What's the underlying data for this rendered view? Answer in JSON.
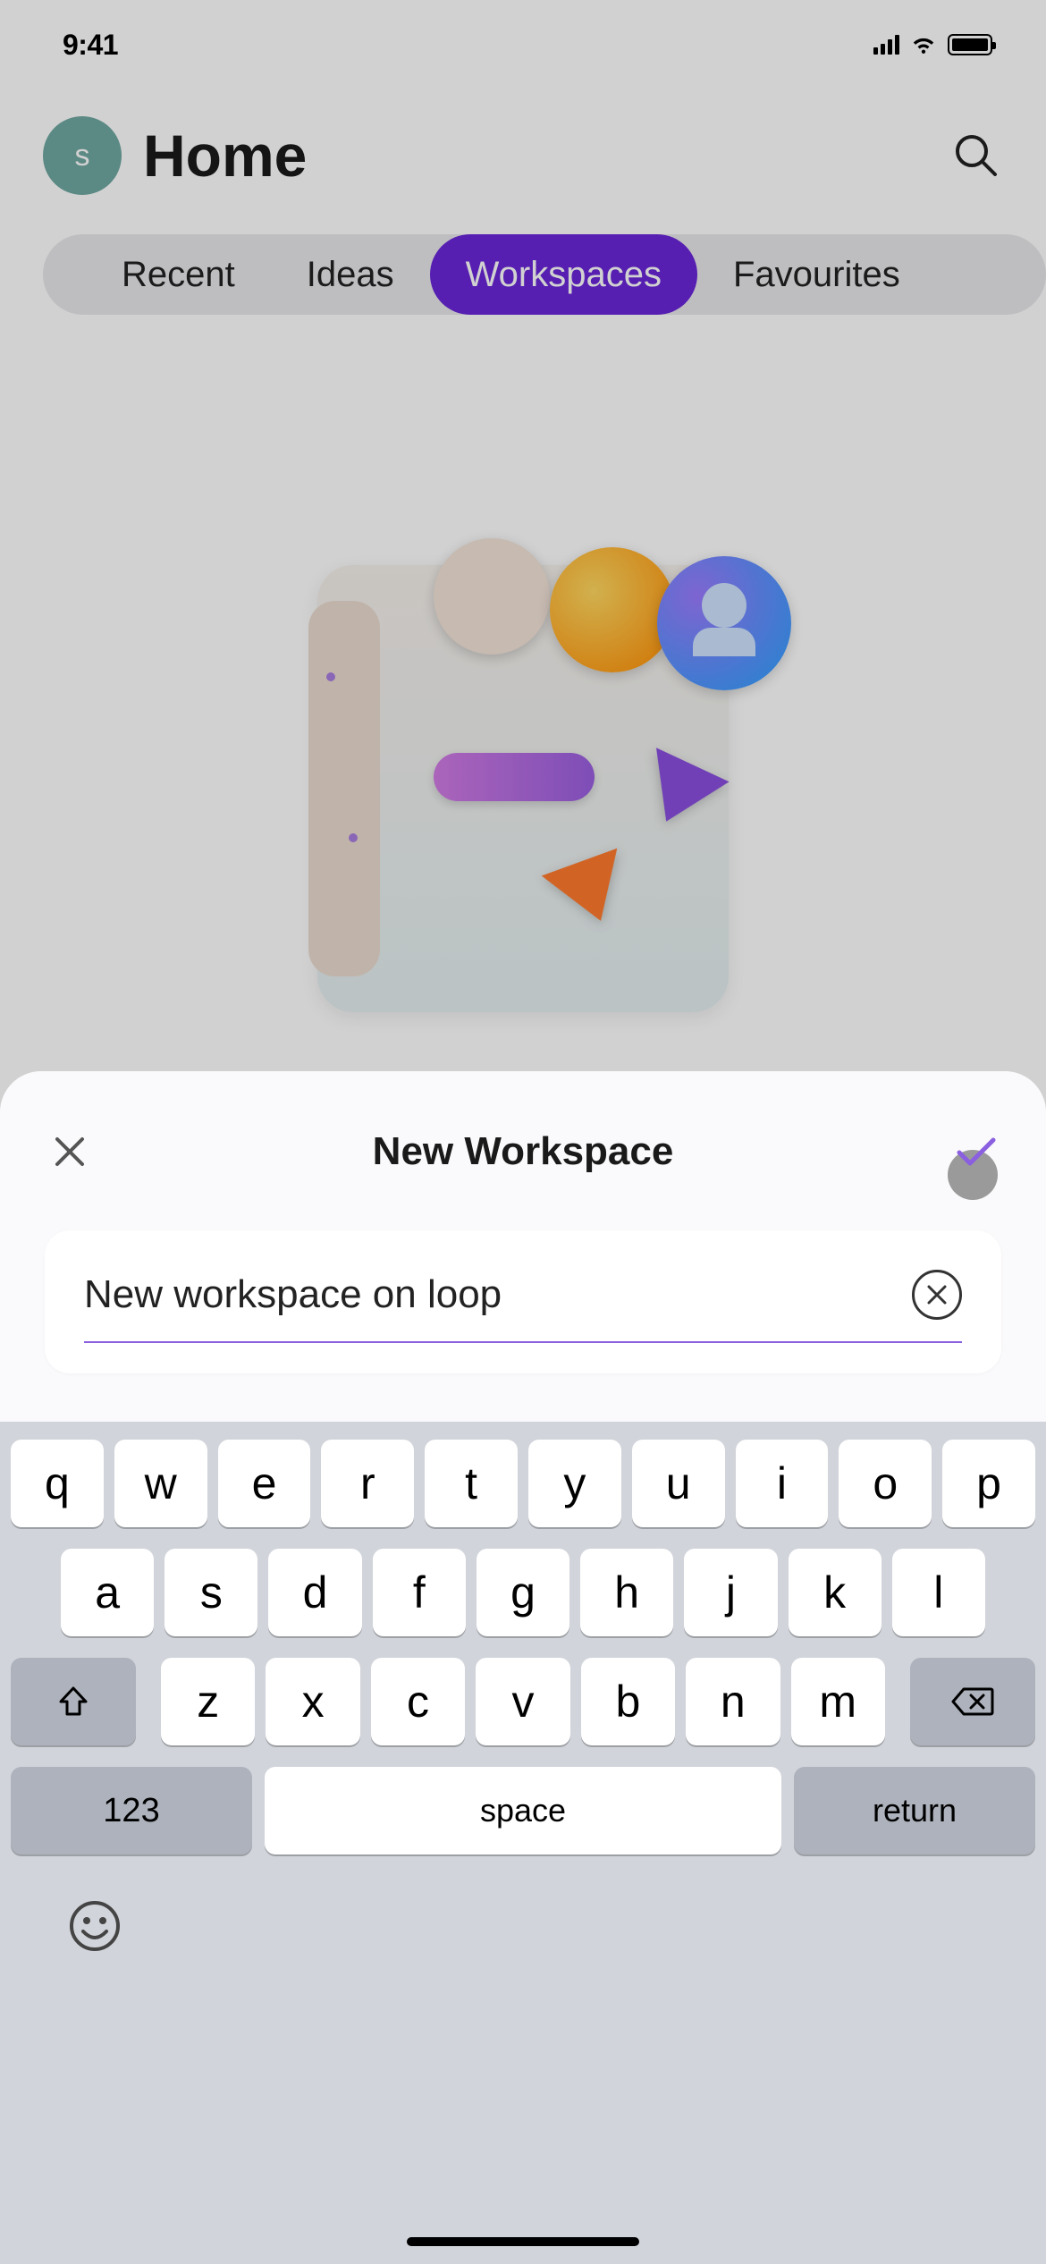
{
  "status": {
    "time": "9:41"
  },
  "header": {
    "avatar_initial": "s",
    "title": "Home"
  },
  "tabs": {
    "items": [
      "Recent",
      "Ideas",
      "Workspaces",
      "Favourites"
    ],
    "active_index": 2
  },
  "sheet": {
    "title": "New Workspace",
    "input_value": "New workspace on loop"
  },
  "keyboard": {
    "row1": [
      "q",
      "w",
      "e",
      "r",
      "t",
      "y",
      "u",
      "i",
      "o",
      "p"
    ],
    "row2": [
      "a",
      "s",
      "d",
      "f",
      "g",
      "h",
      "j",
      "k",
      "l"
    ],
    "row3": [
      "z",
      "x",
      "c",
      "v",
      "b",
      "n",
      "m"
    ],
    "numeric_label": "123",
    "space_label": "space",
    "return_label": "return"
  },
  "colors": {
    "accent": "#6a25d8",
    "underline": "#8a5fe0"
  }
}
